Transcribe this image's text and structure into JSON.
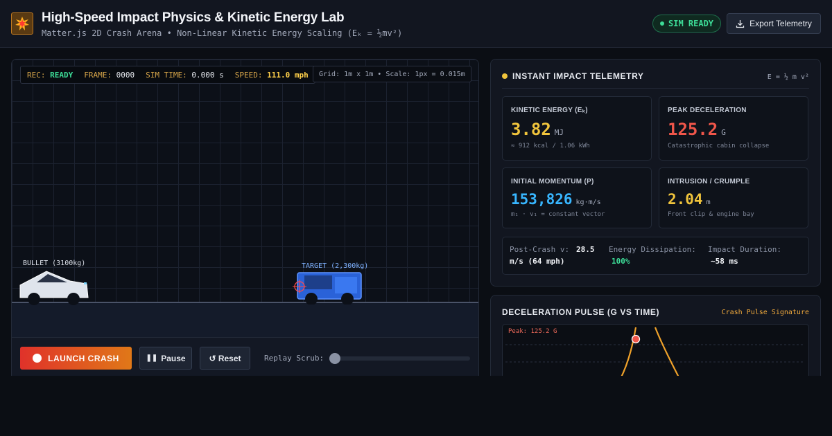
{
  "header": {
    "logo_icon": "explosion-icon",
    "title": "High-Speed Impact Physics & Kinetic Energy Lab",
    "subtitle": "Matter.js 2D Crash Arena • Non-Linear Kinetic Energy Scaling (Eₖ = ½mv²)",
    "status_badge": "SIM READY",
    "export_label": "Export Telemetry"
  },
  "arena": {
    "hud": {
      "rec_label": "REC:",
      "rec_value": "READY",
      "frame_label": "FRAME:",
      "frame_value": "0000",
      "sim_time_label": "SIM TIME:",
      "sim_time_value": "0.000 s",
      "speed_label": "SPEED:",
      "speed_value": "111.0 mph"
    },
    "grid_info": "Grid: 1m x 1m • Scale: 1px = 0.015m",
    "bullet_label": "BULLET (3100kg)",
    "target_label": "TARGET (2,300kg)"
  },
  "controls": {
    "launch_label": "LAUNCH CRASH",
    "pause_label": "Pause",
    "reset_label": "↺ Reset",
    "scrub_label": "Replay Scrub:",
    "scrub_value": 0
  },
  "telemetry": {
    "title": "INSTANT IMPACT TELEMETRY",
    "formula": "E = ½ m v²",
    "kinetic": {
      "label": "KINETIC ENERGY (Eₖ)",
      "value": "3.82",
      "unit": "MJ",
      "sub": "≈ 912 kcal / 1.06 kWh",
      "color": "#f0c43c"
    },
    "decel": {
      "label": "PEAK DECELERATION",
      "value": "125.2",
      "unit": "G",
      "sub": "Catastrophic cabin collapse",
      "color": "#f0564a"
    },
    "momentum": {
      "label": "INITIAL MOMENTUM (P)",
      "value": "153,826",
      "unit": "kg·m/s",
      "sub": "m₁ · v₁ = constant vector",
      "color": "#38b6ff"
    },
    "intrusion": {
      "label": "INTRUSION / CRUMPLE",
      "value": "2.04",
      "unit": "m",
      "sub": "Front clip & engine bay",
      "color": "#f0c43c"
    },
    "post_crash_label": "Post-Crash v:",
    "post_crash_value": "28.5",
    "post_crash_value2": "m/s (64 mph)",
    "dissipation_label": "Energy Dissipation:",
    "dissipation_value": "100%",
    "duration_label": "Impact Duration:",
    "duration_value": "~58 ms"
  },
  "pulse": {
    "title": "DECELERATION PULSE (G VS TIME)",
    "tag": "Crash Pulse Signature",
    "peak_label": "Peak: 125.2 G"
  }
}
